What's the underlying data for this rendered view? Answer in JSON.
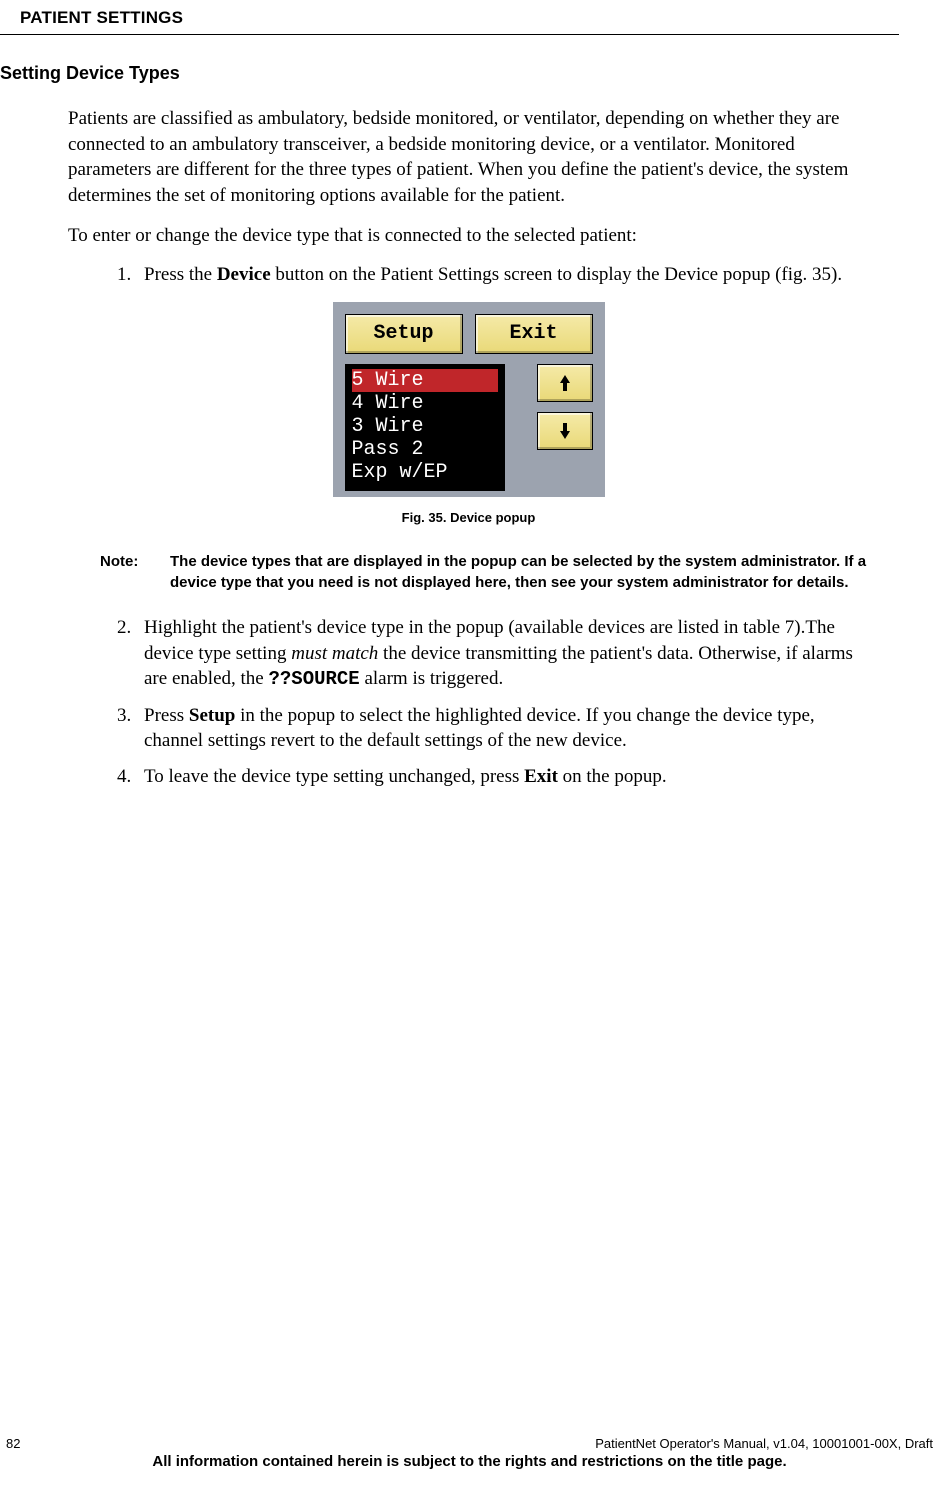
{
  "header": {
    "title": "PATIENT SETTINGS"
  },
  "section": {
    "heading": "Setting Device Types"
  },
  "paragraphs": {
    "p1": "Patients are classified as ambulatory, bedside monitored, or ventilator, depending on whether they are connected to an ambulatory transceiver, a bedside monitoring device, or a ventilator. Monitored parameters are different for the three types of patient. When you define the patient's device, the system determines the set of monitoring options available for the patient.",
    "p2": "To enter or change the device type that is connected to the selected patient:"
  },
  "steps": {
    "s1_a": "Press the ",
    "s1_b": "Device",
    "s1_c": " button on the Patient Settings screen to display the Device popup (fig. 35).",
    "s2_a": "Highlight the patient's device type in the popup (available devices are listed in table 7).The device type setting ",
    "s2_b": "must match",
    "s2_c": " the device transmitting the patient's data. Otherwise, if alarms are enabled, the ",
    "s2_d": "??SOURCE",
    "s2_e": " alarm is triggered.",
    "s3_a": "Press ",
    "s3_b": "Setup",
    "s3_c": " in the popup to select the highlighted device. If you change the device type, channel settings revert to the default settings of the new device.",
    "s4_a": "To leave the device type setting unchanged, press ",
    "s4_b": "Exit",
    "s4_c": " on the popup."
  },
  "popup": {
    "setup": "Setup",
    "exit": "Exit",
    "items": {
      "i0": "5 Wire",
      "i1": "4 Wire",
      "i2": "3 Wire",
      "i3": "Pass 2",
      "i4": "Exp w/EP"
    },
    "selected_index": 0
  },
  "figure": {
    "caption": "Fig. 35. Device popup"
  },
  "note": {
    "label": "Note:",
    "text": "The device types that are displayed in the popup can be selected by the system administrator. If a device type that you need is not displayed here, then see your system administrator for details."
  },
  "footer": {
    "page_number": "82",
    "doc_info": "PatientNet Operator's Manual, v1.04, 10001001-00X, Draft",
    "legal": "All information contained herein is subject to the rights and restrictions on the title page."
  }
}
